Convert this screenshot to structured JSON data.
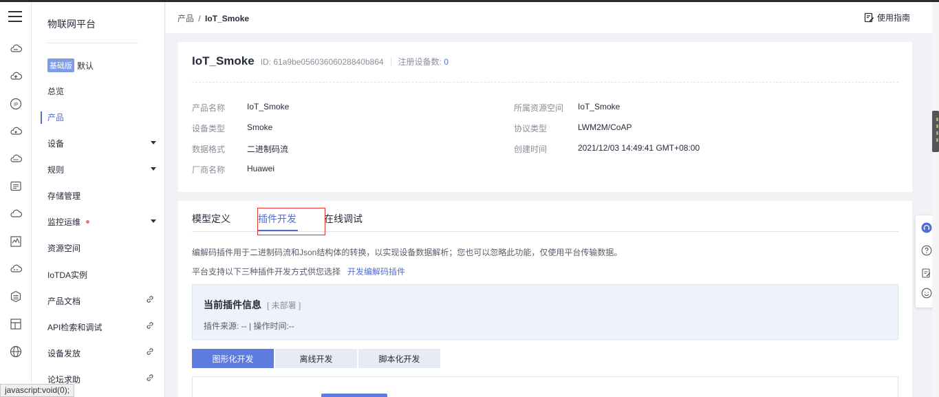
{
  "window": {
    "accent": "#526ecc"
  },
  "rail": {
    "icons": [
      "menu-icon",
      "cloud-icon",
      "cloud-upload-icon",
      "ip-icon",
      "cloud-sync-icon",
      "cloud-dots-icon",
      "message-icon",
      "cloud-outline-icon",
      "chart-icon",
      "cloud-more-icon",
      "database-icon",
      "layout-icon",
      "globe-icon"
    ]
  },
  "sidebar": {
    "brand": "物联网平台",
    "edition_badge": "基础版",
    "edition_name": "默认",
    "items": [
      {
        "label": "总览"
      },
      {
        "label": "产品"
      },
      {
        "label": "设备"
      },
      {
        "label": "规则"
      },
      {
        "label": "存储管理"
      },
      {
        "label": "监控运维"
      },
      {
        "label": "资源空间"
      },
      {
        "label": "IoTDA实例"
      },
      {
        "label": "产品文档"
      },
      {
        "label": "API检索和调试"
      },
      {
        "label": "设备发放"
      },
      {
        "label": "论坛求助"
      }
    ]
  },
  "header": {
    "breadcrumb_root": "产品",
    "breadcrumb_sep": "/",
    "breadcrumb_current": "IoT_Smoke",
    "guide_label": "使用指南"
  },
  "product": {
    "name": "IoT_Smoke",
    "id_text": "ID: 61a9be05603606028840b864",
    "device_count_label": "注册设备数:",
    "device_count": "0",
    "fields_left": [
      {
        "k": "产品名称",
        "v": "IoT_Smoke"
      },
      {
        "k": "设备类型",
        "v": "Smoke"
      },
      {
        "k": "数据格式",
        "v": "二进制码流"
      },
      {
        "k": "厂商名称",
        "v": "Huawei"
      }
    ],
    "fields_right": [
      {
        "k": "所属资源空间",
        "v": "IoT_Smoke"
      },
      {
        "k": "协议类型",
        "v": "LWM2M/CoAP"
      },
      {
        "k": "创建时间",
        "v": "2021/12/03 14:49:41 GMT+08:00"
      }
    ]
  },
  "tabs": [
    {
      "label": "模型定义"
    },
    {
      "label": "插件开发"
    },
    {
      "label": "在线调试"
    }
  ],
  "plugin": {
    "desc1": "编解码插件用于二进制码流和Json结构体的转换，以实现设备数据解析；您也可以忽略此功能，仅使用平台传输数据。",
    "desc2": "平台支持以下三种插件开发方式供您选择",
    "desc2_link": "开发编解码插件",
    "info_title": "当前插件信息",
    "info_status": "[ 未部署 ]",
    "info_meta": "插件来源: --  |  操作时间:--",
    "buttons": [
      {
        "label": "图形化开发"
      },
      {
        "label": "离线开发"
      },
      {
        "label": "脚本化开发"
      }
    ]
  },
  "status_bar": "javascript:void(0);"
}
